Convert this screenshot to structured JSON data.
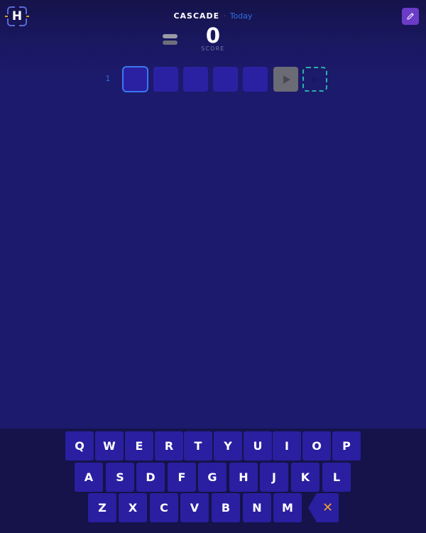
{
  "header": {
    "logo_letter": "H",
    "title": "CASCADE",
    "separator": "·",
    "date_label": "Today"
  },
  "score": {
    "value": "0",
    "label": "SCORE"
  },
  "board": {
    "row_number": "1",
    "tiles": [
      {
        "state": "active",
        "letter": ""
      },
      {
        "state": "empty",
        "letter": ""
      },
      {
        "state": "empty",
        "letter": ""
      },
      {
        "state": "empty",
        "letter": ""
      },
      {
        "state": "empty",
        "letter": ""
      }
    ]
  },
  "icons": {
    "logo": "hexagon-logo-icon",
    "edit": "pencil-icon",
    "toggle": "toggle-bars-icon",
    "play": "play-icon",
    "target_play": "play-icon",
    "delete": "backspace-x-icon"
  },
  "colors": {
    "background": "#1c1a6c",
    "tile": "#2a21a2",
    "active_border": "#3b78f0",
    "target_border": "#2fb0a8",
    "accent_purple": "#6a3cc8",
    "delete_x": "#f0a030",
    "date_blue": "#2f6fe0"
  },
  "keyboard": {
    "row1": [
      "Q",
      "W",
      "E",
      "R",
      "T",
      "Y",
      "U",
      "I",
      "O",
      "P"
    ],
    "row2": [
      "A",
      "S",
      "D",
      "F",
      "G",
      "H",
      "J",
      "K",
      "L"
    ],
    "row3": [
      "Z",
      "X",
      "C",
      "V",
      "B",
      "N",
      "M"
    ],
    "delete_label": "✕"
  }
}
